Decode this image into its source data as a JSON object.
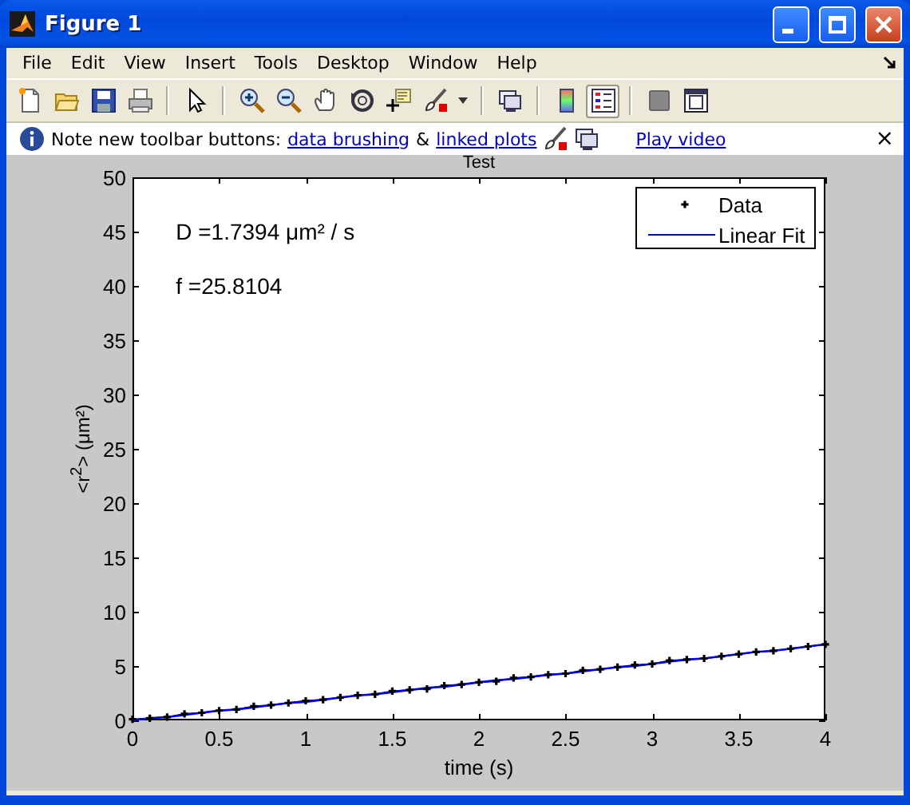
{
  "window": {
    "title": "Figure 1"
  },
  "menu": [
    "File",
    "Edit",
    "View",
    "Insert",
    "Tools",
    "Desktop",
    "Window",
    "Help"
  ],
  "toolbar": [
    {
      "kind": "new",
      "selected": false
    },
    {
      "kind": "open",
      "selected": false
    },
    {
      "kind": "save",
      "selected": false
    },
    {
      "kind": "print",
      "selected": false
    },
    {
      "kind": "sep"
    },
    {
      "kind": "pointer",
      "selected": false
    },
    {
      "kind": "sep"
    },
    {
      "kind": "zoom-in",
      "selected": false
    },
    {
      "kind": "zoom-out",
      "selected": false
    },
    {
      "kind": "pan",
      "selected": false
    },
    {
      "kind": "rotate",
      "selected": false
    },
    {
      "kind": "cursor",
      "selected": false
    },
    {
      "kind": "brush",
      "selected": false
    },
    {
      "kind": "caret",
      "selected": false
    },
    {
      "kind": "sep"
    },
    {
      "kind": "link",
      "selected": false
    },
    {
      "kind": "sep"
    },
    {
      "kind": "colorbar",
      "selected": false
    },
    {
      "kind": "legend",
      "selected": true
    },
    {
      "kind": "sep"
    },
    {
      "kind": "square",
      "selected": false
    },
    {
      "kind": "window",
      "selected": false
    }
  ],
  "info_bar": {
    "note": "Note new toolbar buttons:",
    "link_1": "data brushing",
    "joiner": "&",
    "link_2": "linked plots",
    "link_3": "Play video",
    "close": "×"
  },
  "figure": {
    "chart_data": {
      "type": "line",
      "title": "Test",
      "xlabel": "time (s)",
      "ylabel": "<r$^{2}$> (μm²)",
      "x": [
        0,
        0.1,
        0.2,
        0.3,
        0.4,
        0.5,
        0.6,
        0.7,
        0.8,
        0.9,
        1,
        1.1,
        1.2,
        1.3,
        1.4,
        1.5,
        1.6,
        1.7,
        1.8,
        1.9,
        2,
        2.1,
        2.2,
        2.3,
        2.4,
        2.5,
        2.6,
        2.7,
        2.8,
        2.9,
        3,
        3.1,
        3.2,
        3.3,
        3.4,
        3.5,
        3.6,
        3.7,
        3.8,
        3.9,
        4
      ],
      "series": [
        {
          "name": "Data",
          "color": "#000000",
          "marker": "+",
          "values": [
            0.1,
            0.2,
            0.3,
            0.6,
            0.7,
            0.9,
            1,
            1.3,
            1.4,
            1.6,
            1.8,
            1.9,
            2.1,
            2.3,
            2.4,
            2.7,
            2.8,
            2.9,
            3.2,
            3.3,
            3.5,
            3.6,
            3.9,
            4,
            4.2,
            4.3,
            4.6,
            4.7,
            4.9,
            5.1,
            5.2,
            5.5,
            5.6,
            5.7,
            5.9,
            6.1,
            6.3,
            6.4,
            6.6,
            6.8,
            7
          ]
        },
        {
          "name": "Linear Fit",
          "color": "#0000ff",
          "values": [
            0,
            0.2,
            0.3,
            0.5,
            0.7,
            0.9,
            1,
            1.2,
            1.4,
            1.6,
            1.7,
            1.9,
            2.1,
            2.3,
            2.4,
            2.6,
            2.8,
            3,
            3.1,
            3.3,
            3.5,
            3.7,
            3.8,
            4,
            4.2,
            4.3,
            4.5,
            4.7,
            4.9,
            5,
            5.2,
            5.4,
            5.6,
            5.7,
            5.9,
            6.1,
            6.3,
            6.4,
            6.6,
            6.8,
            7
          ]
        }
      ],
      "legend": "upper right",
      "xlim": [
        0,
        4
      ],
      "ylim": [
        0,
        50
      ],
      "xticks": [
        0,
        0.5,
        1,
        1.5,
        2,
        2.5,
        3,
        3.5,
        4
      ],
      "yticks": [
        0,
        5,
        10,
        15,
        20,
        25,
        30,
        35,
        40,
        45,
        50
      ],
      "annotations": [
        "D =1.7394 μm² / s",
        "f =25.8104"
      ]
    }
  }
}
